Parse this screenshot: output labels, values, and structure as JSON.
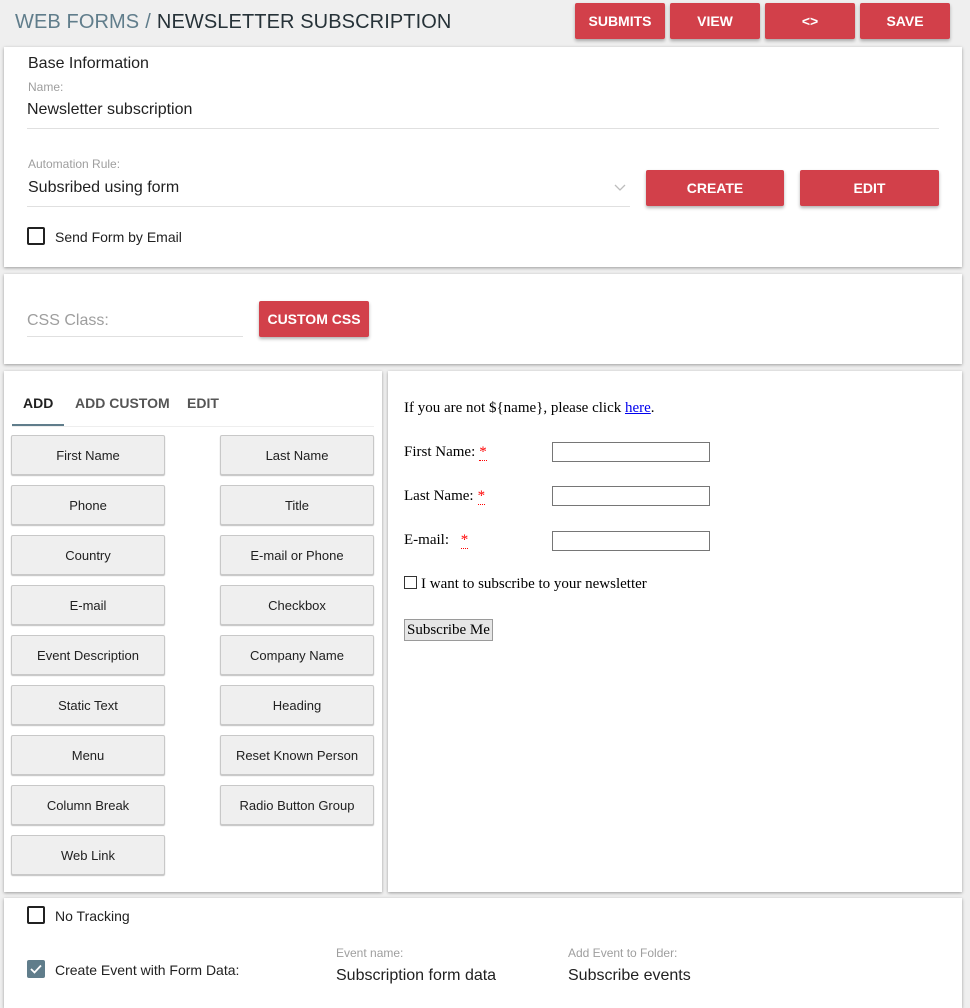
{
  "header": {
    "breadcrumb_root": "WEB FORMS",
    "separator": "/",
    "title": "NEWSLETTER SUBSCRIPTION",
    "buttons": {
      "submits": "SUBMITS",
      "view": "VIEW",
      "code": "<>",
      "save": "SAVE"
    }
  },
  "base_info": {
    "title": "Base Information",
    "name_label": "Name:",
    "name_value": "Newsletter subscription",
    "automation_label": "Automation Rule:",
    "automation_value": "Subsribed using form",
    "create_label": "CREATE",
    "edit_label": "EDIT",
    "send_by_email_label": "Send Form by Email",
    "send_by_email_checked": false
  },
  "css_section": {
    "css_class_placeholder": "CSS Class:",
    "custom_css_label": "CUSTOM CSS"
  },
  "builder": {
    "tabs": [
      {
        "label": "ADD",
        "active": true
      },
      {
        "label": "ADD CUSTOM",
        "active": false
      },
      {
        "label": "EDIT",
        "active": false
      }
    ],
    "field_buttons": [
      "First Name",
      "Last Name",
      "Phone",
      "Title",
      "Country",
      "E-mail or Phone",
      "E-mail",
      "Checkbox",
      "Event Description",
      "Company Name",
      "Static Text",
      "Heading",
      "Menu",
      "Reset Known Person",
      "Column Break",
      "Radio Button Group",
      "Web Link"
    ]
  },
  "preview": {
    "intro_text": "If you are not ${name}, please click ",
    "intro_link": "here",
    "intro_end": ".",
    "required_mark": "*",
    "fields": [
      {
        "label": "First Name:",
        "value": ""
      },
      {
        "label": "Last Name:",
        "value": ""
      },
      {
        "label": "E-mail: ",
        "value": ""
      }
    ],
    "subscribe_checkbox_label": "I want to subscribe to your newsletter",
    "subscribe_checked": false,
    "submit_label": "Subscribe Me"
  },
  "tracking": {
    "no_tracking_label": "No Tracking",
    "no_tracking_checked": false,
    "create_event_label": "Create Event with Form Data:",
    "create_event_checked": true,
    "event_name_label": "Event name:",
    "event_name_value": "Subscription form data",
    "event_folder_label": "Add Event to Folder:",
    "event_folder_value": "Subscribe events"
  }
}
